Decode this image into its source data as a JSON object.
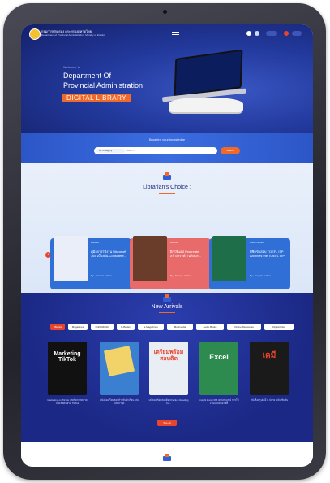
{
  "header": {
    "brand_th": "กรมการปกครอง กระทรวงมหาดไทย",
    "brand_en": "Department of Provincial Administration, Ministry of Interior",
    "welcome": "Welcome to",
    "title_line1": "Department Of",
    "title_line2": "Provincial Administration",
    "badge": "DIGITAL LIBRARY"
  },
  "search": {
    "label": "Broaden your knowledge",
    "category": "All Category",
    "placeholder": "Search",
    "button": "Search"
  },
  "librarian": {
    "title": "Librarian's Choice :",
    "cards": [
      {
        "label": "eBooks",
        "title": "คู่มือการใช้งาน Microsoft 365 เบื้องต้น Considere...",
        "byline": "By : Sample Author",
        "color": "#2f6fd6",
        "img": "#e9eef8"
      },
      {
        "label": "eBooks",
        "title": "ฝึกใช้แอป Procreate สร้างสรรค์งานศิลปะ...",
        "byline": "By : Sample Author",
        "color": "#e86a6a",
        "img": "#6a3c2a"
      },
      {
        "label": "Audio Books",
        "title": "พิชิตข้อสอบ TOEFL ITP Archives the TOEFL ITP",
        "byline": "By : Sample Author",
        "color": "#2f6fd6",
        "img": "#1f6e4a"
      }
    ]
  },
  "new_arrivals": {
    "title": "New Arrivals",
    "tabs": [
      "eBooks",
      "Magazines",
      "OnDEMAND",
      "E-Books",
      "E-Magazines",
      "Multimedia",
      "Audio Books",
      "Online Resources",
      "Digital Files"
    ],
    "active_tab": 0,
    "books": [
      {
        "cover_title": "Marketing TikTok",
        "caption": "Marketing on TikTok เทคนิคการตลาดบนแพลตฟอร์ม TikTok",
        "color": "#111111"
      },
      {
        "cover_title": "",
        "caption": "หนังสือเตรียมสอบสำหรับนักเรียน เล่มใหม่ล่าสุด",
        "color": "#3b7fd0"
      },
      {
        "cover_title": "เตรียมพร้อม สอบติด",
        "caption": "เตรียมพร้อมสอบติด Practice Reading Co...",
        "color": "#e9eef5"
      },
      {
        "cover_title": "Excel",
        "caption": "Insight Excel 365 ฉบับสมบูรณ์ การใช้งานแบบมืออาชีพ",
        "color": "#2e8b4f"
      },
      {
        "cover_title": "เคมี",
        "caption": "หนังสือสรุปเคมี ม.ปลาย ฉบับเข้มข้น",
        "color": "#1a1a1a"
      }
    ],
    "see_all": "See All"
  },
  "colors": {
    "accent": "#e8452c",
    "primary": "#2f5ed6",
    "navy": "#1b2885"
  }
}
